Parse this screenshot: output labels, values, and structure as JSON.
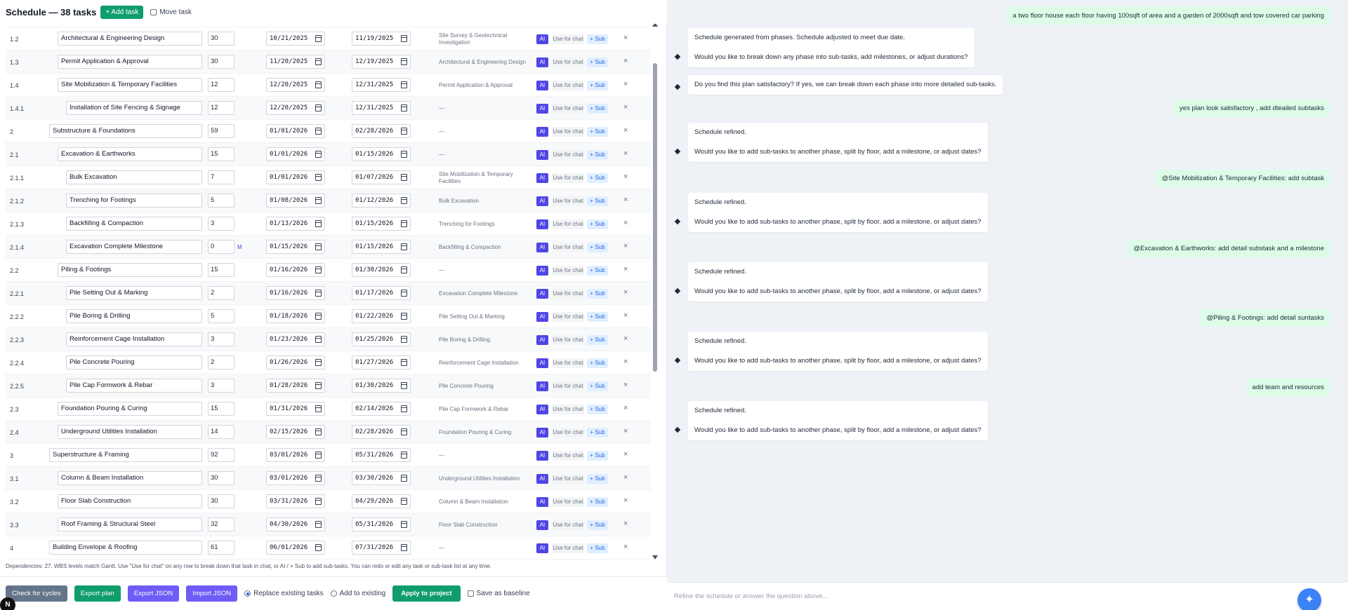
{
  "header": {
    "title": "Schedule — 38 tasks",
    "add_task_label": "+ Add task",
    "move_task_label": "Move task"
  },
  "row_buttons": {
    "ai": "AI",
    "use_for_chat": "Use for chat",
    "sub": "+ Sub",
    "delete": "×"
  },
  "tasks": [
    {
      "wbs": "1.2",
      "name": "Architectural & Engineering Design",
      "duration": "30",
      "start": "10/21/2025",
      "finish": "11/19/2025",
      "predecessor": "Site Survey & Geotechnical Investigation",
      "milestone": ""
    },
    {
      "wbs": "1.3",
      "name": "Permit Application & Approval",
      "duration": "30",
      "start": "11/20/2025",
      "finish": "12/19/2025",
      "predecessor": "Architectural & Engineering Design",
      "milestone": ""
    },
    {
      "wbs": "1.4",
      "name": "Site Mobilization & Temporary Facilities",
      "duration": "12",
      "start": "12/20/2025",
      "finish": "12/31/2025",
      "predecessor": "Permit Application & Approval",
      "milestone": ""
    },
    {
      "wbs": "1.4.1",
      "name": "Installation of Site Fencing & Signage",
      "duration": "12",
      "start": "12/20/2025",
      "finish": "12/31/2025",
      "predecessor": "—",
      "milestone": ""
    },
    {
      "wbs": "2",
      "name": "Substructure & Foundations",
      "duration": "59",
      "start": "01/01/2026",
      "finish": "02/28/2026",
      "predecessor": "—",
      "milestone": ""
    },
    {
      "wbs": "2.1",
      "name": "Excavation & Earthworks",
      "duration": "15",
      "start": "01/01/2026",
      "finish": "01/15/2026",
      "predecessor": "—",
      "milestone": ""
    },
    {
      "wbs": "2.1.1",
      "name": "Bulk Excavation",
      "duration": "7",
      "start": "01/01/2026",
      "finish": "01/07/2026",
      "predecessor": "Site Mobilization & Temporary Facilities",
      "milestone": ""
    },
    {
      "wbs": "2.1.2",
      "name": "Trenching for Footings",
      "duration": "5",
      "start": "01/08/2026",
      "finish": "01/12/2026",
      "predecessor": "Bulk Excavation",
      "milestone": ""
    },
    {
      "wbs": "2.1.3",
      "name": "Backfilling & Compaction",
      "duration": "3",
      "start": "01/13/2026",
      "finish": "01/15/2026",
      "predecessor": "Trenching for Footings",
      "milestone": ""
    },
    {
      "wbs": "2.1.4",
      "name": "Excavation Complete Milestone",
      "duration": "0",
      "start": "01/15/2026",
      "finish": "01/15/2026",
      "predecessor": "Backfilling & Compaction",
      "milestone": "M"
    },
    {
      "wbs": "2.2",
      "name": "Piling & Footings",
      "duration": "15",
      "start": "01/16/2026",
      "finish": "01/30/2026",
      "predecessor": "—",
      "milestone": ""
    },
    {
      "wbs": "2.2.1",
      "name": "Pile Setting Out & Marking",
      "duration": "2",
      "start": "01/16/2026",
      "finish": "01/17/2026",
      "predecessor": "Excavation Complete Milestone",
      "milestone": ""
    },
    {
      "wbs": "2.2.2",
      "name": "Pile Boring & Drilling",
      "duration": "5",
      "start": "01/18/2026",
      "finish": "01/22/2026",
      "predecessor": "Pile Setting Out & Marking",
      "milestone": ""
    },
    {
      "wbs": "2.2.3",
      "name": "Reinforcement Cage Installation",
      "duration": "3",
      "start": "01/23/2026",
      "finish": "01/25/2026",
      "predecessor": "Pile Boring & Drilling",
      "milestone": ""
    },
    {
      "wbs": "2.2.4",
      "name": "Pile Concrete Pouring",
      "duration": "2",
      "start": "01/26/2026",
      "finish": "01/27/2026",
      "predecessor": "Reinforcement Cage Installation",
      "milestone": ""
    },
    {
      "wbs": "2.2.5",
      "name": "Pile Cap Formwork & Rebar",
      "duration": "3",
      "start": "01/28/2026",
      "finish": "01/30/2026",
      "predecessor": "Pile Concrete Pouring",
      "milestone": ""
    },
    {
      "wbs": "2.3",
      "name": "Foundation Pouring & Curing",
      "duration": "15",
      "start": "01/31/2026",
      "finish": "02/14/2026",
      "predecessor": "Pile Cap Formwork & Rebar",
      "milestone": ""
    },
    {
      "wbs": "2.4",
      "name": "Underground Utilities Installation",
      "duration": "14",
      "start": "02/15/2026",
      "finish": "02/28/2026",
      "predecessor": "Foundation Pouring & Curing",
      "milestone": ""
    },
    {
      "wbs": "3",
      "name": "Superstructure & Framing",
      "duration": "92",
      "start": "03/01/2026",
      "finish": "05/31/2026",
      "predecessor": "—",
      "milestone": ""
    },
    {
      "wbs": "3.1",
      "name": "Column & Beam Installation",
      "duration": "30",
      "start": "03/01/2026",
      "finish": "03/30/2026",
      "predecessor": "Underground Utilities Installation",
      "milestone": ""
    },
    {
      "wbs": "3.2",
      "name": "Floor Slab Construction",
      "duration": "30",
      "start": "03/31/2026",
      "finish": "04/29/2026",
      "predecessor": "Column & Beam Installation",
      "milestone": ""
    },
    {
      "wbs": "3.3",
      "name": "Roof Framing & Structural Steel",
      "duration": "32",
      "start": "04/30/2026",
      "finish": "05/31/2026",
      "predecessor": "Floor Slab Construction",
      "milestone": ""
    },
    {
      "wbs": "4",
      "name": "Building Envelope & Roofing",
      "duration": "61",
      "start": "06/01/2026",
      "finish": "07/31/2026",
      "predecessor": "—",
      "milestone": ""
    }
  ],
  "footnote": "Dependencies: 27. WBS levels match Gantt. Use \"Use for chat\" on any row to break down that task in chat, or AI / + Sub to add sub-tasks. You can redo or edit any task or sub-task list at any time.",
  "bottom": {
    "check_cycles": "Check for cycles",
    "export_plan": "Export plan",
    "export_json": "Export JSON",
    "import_json": "Import JSON",
    "replace_existing": "Replace existing tasks",
    "add_to_existing": "Add to existing",
    "apply_to_project": "Apply to project",
    "save_as_baseline": "Save as baseline",
    "corner_badge": "N"
  },
  "chat": {
    "messages": [
      {
        "role": "user",
        "text": "a two floor house each floor having 100sqft of area and a garden of 2000sqft and tow covered car parking"
      },
      {
        "role": "bot",
        "lines": [
          "Schedule generated from phases. Schedule adjusted to meet due date.",
          "Would you like to break down any phase into sub-tasks, add milestones, or adjust durations?"
        ]
      },
      {
        "role": "bot",
        "lines": [
          "Do you find this plan satisfactory? If yes, we can break down each phase into more detailed sub-tasks."
        ]
      },
      {
        "role": "user",
        "text": "yes plan look satisfactory , add dteailed subtasks"
      },
      {
        "role": "bot",
        "lines": [
          "Schedule refined.",
          "Would you like to add sub-tasks to another phase, split by floor, add a milestone, or adjust dates?"
        ]
      },
      {
        "role": "user",
        "text": "@Site Mobilization & Temporary Facilities: add subtask"
      },
      {
        "role": "bot",
        "lines": [
          "Schedule refined.",
          "Would you like to add sub-tasks to another phase, split by floor, add a milestone, or adjust dates?"
        ]
      },
      {
        "role": "user",
        "text": "@Excavation & Earthworks: add detail substask and a milestone"
      },
      {
        "role": "bot",
        "lines": [
          "Schedule refined.",
          "Would you like to add sub-tasks to another phase, split by floor, add a milestone, or adjust dates?"
        ]
      },
      {
        "role": "user",
        "text": "@Piling & Footings: add detail suntasks"
      },
      {
        "role": "bot",
        "lines": [
          "Schedule refined.",
          "Would you like to add sub-tasks to another phase, split by floor, add a milestone, or adjust dates?"
        ]
      },
      {
        "role": "user",
        "text": "add  team and resources"
      },
      {
        "role": "bot",
        "lines": [
          "Schedule refined.",
          "Would you like to add sub-tasks to another phase, split by floor, add a milestone, or adjust dates?"
        ]
      }
    ],
    "input_placeholder": "Refine the schedule or answer the question above...",
    "send_icon": "sparkle-icon"
  }
}
